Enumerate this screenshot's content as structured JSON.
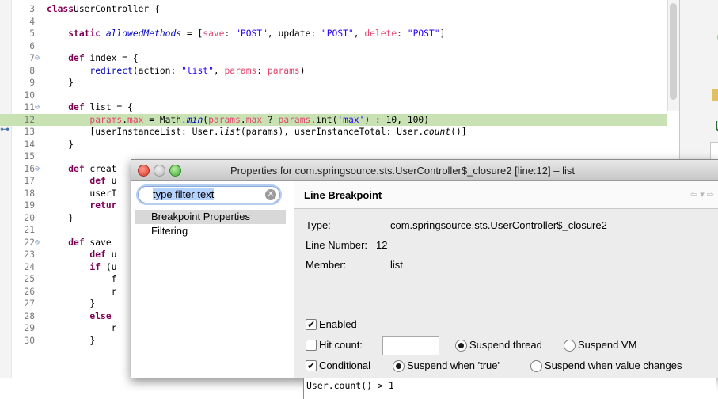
{
  "editor": {
    "lines": [
      {
        "n": "3",
        "fold": "",
        "segs": [
          [
            "kw",
            "class"
          ],
          [
            "",
            "UserController {"
          ]
        ]
      },
      {
        "n": "4",
        "fold": "",
        "segs": []
      },
      {
        "n": "5",
        "fold": "",
        "segs": [
          [
            "",
            "    "
          ],
          [
            "kw",
            "static"
          ],
          [
            "",
            ""
          ],
          [
            "sf",
            "allowedMethods"
          ],
          [
            "",
            " = ["
          ],
          [
            "fld",
            "save"
          ],
          [
            "",
            ": "
          ],
          [
            "str",
            "\"POST\""
          ],
          [
            "",
            ", update: "
          ],
          [
            "str",
            "\"POST\""
          ],
          [
            "",
            ", "
          ],
          [
            "fld",
            "delete"
          ],
          [
            "",
            ": "
          ],
          [
            "str",
            "\"POST\""
          ],
          [
            "",
            "]"
          ]
        ]
      },
      {
        "n": "6",
        "fold": "",
        "segs": []
      },
      {
        "n": "7",
        "fold": "⊖",
        "segs": [
          [
            "",
            "    "
          ],
          [
            "kw",
            "def"
          ],
          [
            "",
            " index = {"
          ]
        ]
      },
      {
        "n": "8",
        "fold": "",
        "segs": [
          [
            "",
            "        "
          ],
          [
            "meth",
            "redirect"
          ],
          [
            "",
            "(action: "
          ],
          [
            "str",
            "\"list\""
          ],
          [
            "",
            ", "
          ],
          [
            "fld",
            "params"
          ],
          [
            "",
            ": "
          ],
          [
            "fld",
            "params"
          ],
          [
            "",
            ")"
          ]
        ]
      },
      {
        "n": "9",
        "fold": "",
        "segs": [
          [
            "",
            "    }"
          ]
        ]
      },
      {
        "n": "10",
        "fold": "",
        "segs": []
      },
      {
        "n": "11",
        "fold": "⊖",
        "segs": [
          [
            "",
            "    "
          ],
          [
            "kw",
            "def"
          ],
          [
            "",
            " list = {"
          ]
        ]
      },
      {
        "n": "12",
        "fold": "",
        "hl": true,
        "segs": [
          [
            "",
            "        "
          ],
          [
            "fld",
            "params"
          ],
          [
            "",
            "."
          ],
          [
            "fld",
            "max"
          ],
          [
            "",
            " = Math."
          ],
          [
            "sf",
            "min"
          ],
          [
            "",
            "("
          ],
          [
            "fld",
            "params"
          ],
          [
            "",
            "."
          ],
          [
            "fld",
            "max"
          ],
          [
            "",
            " ? "
          ],
          [
            "fld",
            "params"
          ],
          [
            "",
            "."
          ],
          [
            "ul",
            "int"
          ],
          [
            "",
            "("
          ],
          [
            "str",
            "'max'"
          ],
          [
            "",
            ") : 10, 100)"
          ]
        ]
      },
      {
        "n": "13",
        "fold": "",
        "segs": [
          [
            "",
            "        [userInstanceList: User."
          ],
          [
            "it",
            "list"
          ],
          [
            "",
            "(params), userInstanceTotal: User."
          ],
          [
            "it",
            "count"
          ],
          [
            "",
            "()]"
          ]
        ]
      },
      {
        "n": "14",
        "fold": "",
        "segs": [
          [
            "",
            "    }"
          ]
        ]
      },
      {
        "n": "15",
        "fold": "",
        "segs": []
      },
      {
        "n": "16",
        "fold": "⊖",
        "segs": [
          [
            "",
            "    "
          ],
          [
            "kw",
            "def"
          ],
          [
            "",
            " creat"
          ]
        ]
      },
      {
        "n": "17",
        "fold": "",
        "segs": [
          [
            "",
            "        "
          ],
          [
            "kw",
            "def"
          ],
          [
            "",
            " u"
          ]
        ]
      },
      {
        "n": "18",
        "fold": "",
        "segs": [
          [
            "",
            "        userI"
          ]
        ]
      },
      {
        "n": "19",
        "fold": "",
        "segs": [
          [
            "",
            "        "
          ],
          [
            "kw",
            "retur"
          ]
        ]
      },
      {
        "n": "20",
        "fold": "",
        "segs": [
          [
            "",
            "    }"
          ]
        ]
      },
      {
        "n": "21",
        "fold": "",
        "segs": []
      },
      {
        "n": "22",
        "fold": "⊖",
        "segs": [
          [
            "",
            "    "
          ],
          [
            "kw",
            "def"
          ],
          [
            "",
            " save "
          ]
        ]
      },
      {
        "n": "23",
        "fold": "",
        "segs": [
          [
            "",
            "        "
          ],
          [
            "kw",
            "def"
          ],
          [
            "",
            " u"
          ]
        ]
      },
      {
        "n": "24",
        "fold": "",
        "segs": [
          [
            "",
            "        "
          ],
          [
            "kw",
            "if"
          ],
          [
            "",
            " (u"
          ]
        ]
      },
      {
        "n": "25",
        "fold": "",
        "segs": [
          [
            "",
            "            f"
          ]
        ]
      },
      {
        "n": "26",
        "fold": "",
        "segs": [
          [
            "",
            "            r"
          ]
        ]
      },
      {
        "n": "27",
        "fold": "",
        "segs": [
          [
            "",
            "        }"
          ]
        ]
      },
      {
        "n": "28",
        "fold": "",
        "segs": [
          [
            "",
            "        "
          ],
          [
            "kw",
            "else"
          ]
        ]
      },
      {
        "n": "29",
        "fold": "",
        "segs": [
          [
            "",
            "            r"
          ]
        ]
      },
      {
        "n": "30",
        "fold": "",
        "segs": [
          [
            "",
            "        }"
          ]
        ]
      }
    ]
  },
  "right_panel": {
    "letter1": "(",
    "letter2": "U"
  },
  "dialog": {
    "title": "Properties for com.springsource.sts.UserController$_closure2 [line:12] – list",
    "filter_text": "type filter text",
    "nav_items": [
      "Breakpoint Properties",
      "Filtering"
    ],
    "section_title": "Line Breakpoint",
    "type_label": "Type:",
    "type_value": "com.springsource.sts.UserController$_closure2",
    "line_label": "Line Number:",
    "line_value": "12",
    "member_label": "Member:",
    "member_value": "list",
    "enabled_label": "Enabled",
    "enabled_checked": true,
    "hit_count_label": "Hit count:",
    "hit_count_value": "",
    "hit_count_checked": false,
    "suspend_thread_label": "Suspend thread",
    "suspend_vm_label": "Suspend VM",
    "suspend_mode": "thread",
    "conditional_label": "Conditional",
    "conditional_checked": true,
    "suspend_true_label": "Suspend when 'true'",
    "suspend_changes_label": "Suspend when value changes",
    "condition_mode": "true",
    "condition_text": "User.count() > 1"
  }
}
